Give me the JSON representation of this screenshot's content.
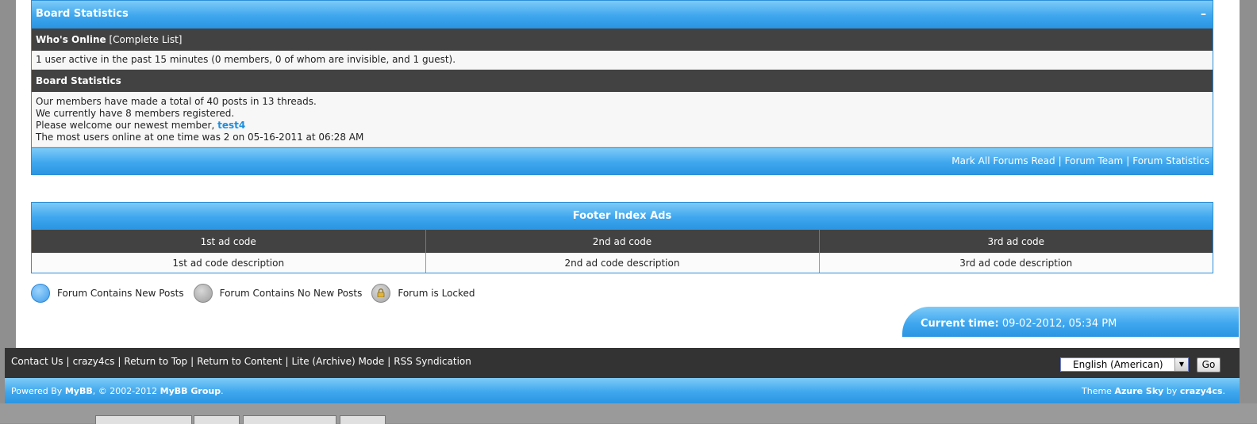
{
  "board_stats": {
    "header_title": "Board Statistics",
    "collapse_icon": "minus-icon",
    "whos_online_label": "Who's Online",
    "complete_list_link": "[Complete List]",
    "online_text": "1 user active in the past 15 minutes (0 members, 0 of whom are invisible, and 1 guest).",
    "stats_subheader": "Board Statistics",
    "line1": "Our members have made a total of 40 posts in 13 threads.",
    "line2": "We currently have 8 members registered.",
    "line3_prefix": "Please welcome our newest member, ",
    "newest_member": "test4",
    "line4": "The most users online at one time was 2 on 05-16-2011 at 06:28 AM",
    "footer_links": [
      "Mark All Forums Read",
      "Forum Team",
      "Forum Statistics"
    ]
  },
  "ads": {
    "title": "Footer Index Ads",
    "columns": [
      "1st ad code",
      "2nd ad code",
      "3rd ad code"
    ],
    "descriptions": [
      "1st ad code description",
      "2nd ad code description",
      "3rd ad code description"
    ]
  },
  "legend": {
    "new_posts": "Forum Contains New Posts",
    "no_new_posts": "Forum Contains No New Posts",
    "locked": "Forum is Locked"
  },
  "current_time": {
    "label": "Current time:",
    "value": "09-02-2012, 05:34 PM"
  },
  "footer": {
    "links": [
      "Contact Us",
      "crazy4cs",
      "Return to Top",
      "Return to Content",
      "Lite (Archive) Mode",
      "RSS Syndication"
    ],
    "language_selected": "English (American)",
    "go_label": "Go",
    "powered_prefix": "Powered By ",
    "powered_mybb": "MyBB",
    "powered_mid": ", © 2002-2012 ",
    "powered_group": "MyBB Group",
    "powered_suffix": ".",
    "theme_prefix": "Theme ",
    "theme_name": "Azure Sky",
    "theme_by": " by ",
    "theme_author": "crazy4cs",
    "theme_suffix": "."
  },
  "colors": {
    "accent_blue": "#3fa7ee",
    "dark_row": "#424242",
    "footer_dark": "#333333",
    "link_blue": "#1d8ee0"
  }
}
